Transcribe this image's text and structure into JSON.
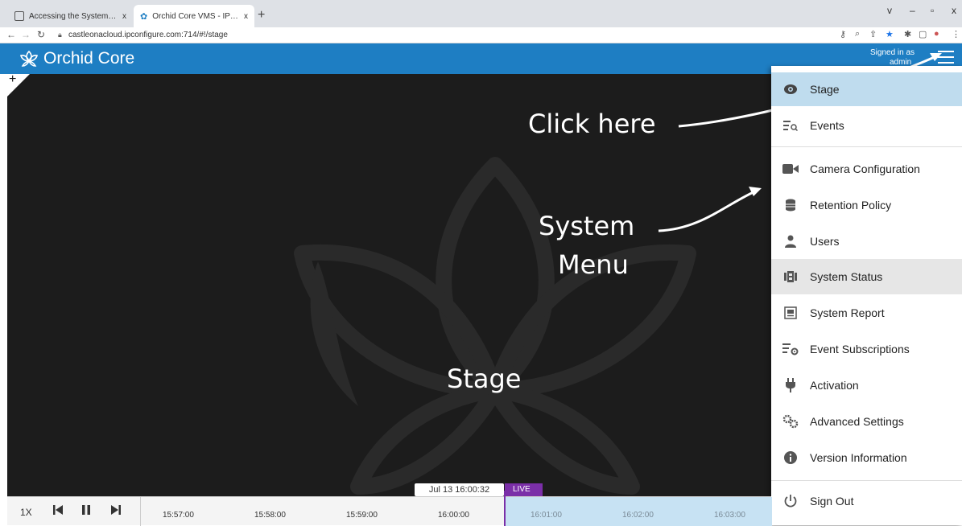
{
  "browser": {
    "tabs": [
      {
        "title": "Accessing the System Menu - Or",
        "close": "x"
      },
      {
        "title": "Orchid Core VMS - IPConfigure",
        "close": "x"
      }
    ],
    "new_tab": "+",
    "url": "castleonacloud.ipconfigure.com:714/#!/stage",
    "window_controls": [
      "v",
      "–",
      "▫",
      "x"
    ]
  },
  "app": {
    "title": "Orchid Core",
    "signed_in_label": "Signed in as",
    "user": "admin",
    "brand_color": "#1e7ec3"
  },
  "annotations": {
    "click_here": "Click here",
    "system_menu_line1": "System",
    "system_menu_line2": "Menu",
    "stage": "Stage"
  },
  "menu": {
    "items": [
      {
        "label": "Stage",
        "icon": "eye-icon",
        "state": "active"
      },
      {
        "label": "Events",
        "icon": "events-list-icon"
      },
      {
        "label": "Camera Configuration",
        "icon": "video-camera-icon"
      },
      {
        "label": "Retention Policy",
        "icon": "database-icon"
      },
      {
        "label": "Users",
        "icon": "user-icon"
      },
      {
        "label": "System Status",
        "icon": "system-status-icon",
        "state": "hover"
      },
      {
        "label": "System Report",
        "icon": "report-icon"
      },
      {
        "label": "Event Subscriptions",
        "icon": "event-subscriptions-icon"
      },
      {
        "label": "Activation",
        "icon": "plug-icon"
      },
      {
        "label": "Advanced Settings",
        "icon": "gears-icon"
      },
      {
        "label": "Version Information",
        "icon": "info-icon"
      },
      {
        "label": "Sign Out",
        "icon": "power-icon"
      }
    ],
    "active_color": "#bfdcee"
  },
  "timeline": {
    "speed": "1X",
    "date_chip": "Jul 13 16:00:32",
    "live": "LIVE",
    "ticks": [
      "15:57:00",
      "15:58:00",
      "15:59:00",
      "16:00:00",
      "16:01:00",
      "16:02:00",
      "16:03:00"
    ],
    "live_color": "#7b2fa8"
  }
}
